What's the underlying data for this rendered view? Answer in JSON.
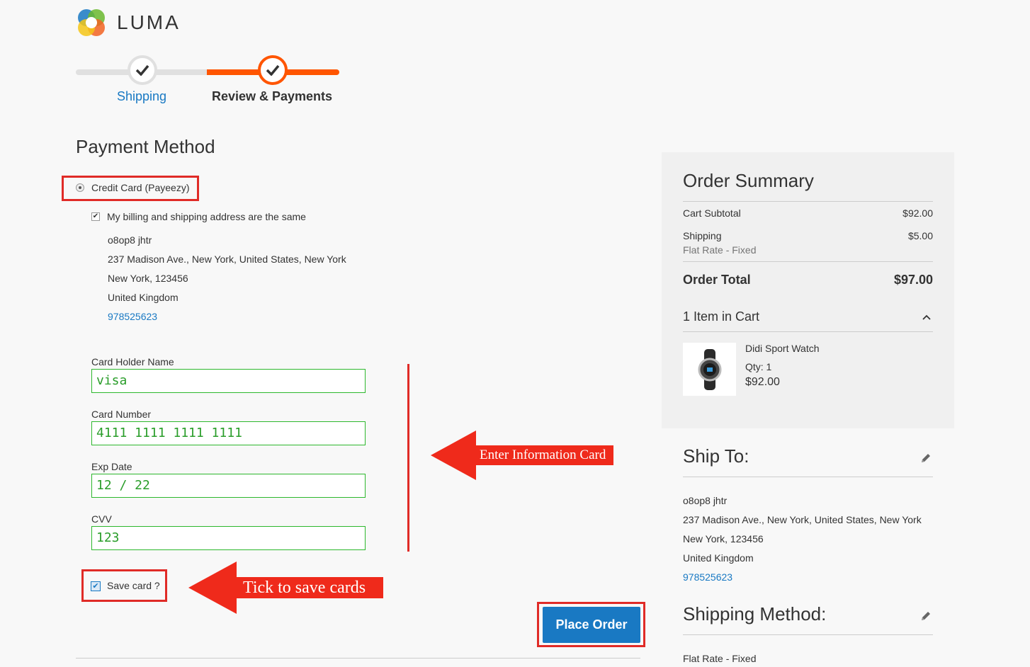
{
  "brand": {
    "name": "LUMA"
  },
  "progress": {
    "steps": [
      {
        "label": "Shipping",
        "state": "done"
      },
      {
        "label": "Review & Payments",
        "state": "active"
      }
    ]
  },
  "payment": {
    "title": "Payment Method",
    "method_label": "Credit Card (Payeezy)",
    "billing_same_label": "My billing and shipping address are the same",
    "billing_same_checked": true,
    "address": {
      "name": "o8op8 jhtr",
      "street": "237 Madison Ave., New York, United States, New York",
      "city_zip": "New York, 123456",
      "country": "United Kingdom",
      "phone": "978525623"
    },
    "fields": {
      "holder_label": "Card Holder Name",
      "holder_value": "visa",
      "number_label": "Card Number",
      "number_value": "4111 1111 1111 1111",
      "exp_label": "Exp Date",
      "exp_value": "12 / 22",
      "cvv_label": "CVV",
      "cvv_value": "123"
    },
    "save_card_label": "Save card ?",
    "save_card_checked": true,
    "place_order_label": "Place Order"
  },
  "annotations": {
    "enter_info": "Enter Information Card",
    "tick_save": "Tick to save cards",
    "color": "#ef2a1b"
  },
  "summary": {
    "title": "Order Summary",
    "subtotal_label": "Cart Subtotal",
    "subtotal_value": "$92.00",
    "shipping_label": "Shipping",
    "shipping_value": "$5.00",
    "shipping_method": "Flat Rate - Fixed",
    "total_label": "Order Total",
    "total_value": "$97.00",
    "items_label": "1 Item in Cart",
    "item": {
      "name": "Didi Sport Watch",
      "qty": "Qty: 1",
      "price": "$92.00"
    }
  },
  "ship_to": {
    "title": "Ship To:",
    "name": "o8op8 jhtr",
    "street": "237 Madison Ave., New York, United States, New York",
    "city_zip": "New York, 123456",
    "country": "United Kingdom",
    "phone": "978525623"
  },
  "shipping_method": {
    "title": "Shipping Method:",
    "value": "Flat Rate - Fixed"
  },
  "colors": {
    "accent_orange": "#ff5501",
    "link_blue": "#1979c3",
    "annotation_red": "#e02b27"
  }
}
